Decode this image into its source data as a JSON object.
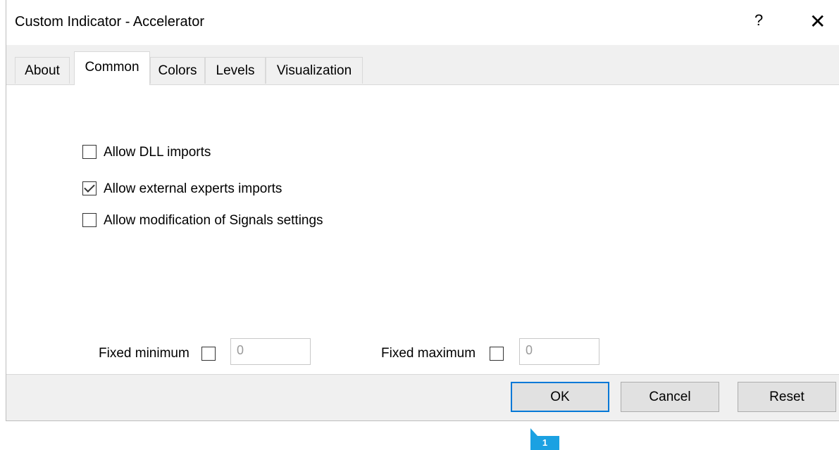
{
  "window": {
    "title": "Custom Indicator - Accelerator",
    "help_glyph": "?",
    "close_glyph": "✕"
  },
  "tabs": [
    {
      "label": "About"
    },
    {
      "label": "Common",
      "active": true
    },
    {
      "label": "Colors"
    },
    {
      "label": "Levels"
    },
    {
      "label": "Visualization"
    }
  ],
  "options": [
    {
      "label": "Allow DLL imports",
      "checked": false
    },
    {
      "label": "Allow external experts imports",
      "checked": true
    },
    {
      "label": "Allow modification of Signals settings",
      "checked": false
    }
  ],
  "scale": {
    "fixed_minimum": {
      "label": "Fixed minimum",
      "checked": false,
      "value": "0"
    },
    "fixed_maximum": {
      "label": "Fixed maximum",
      "checked": false,
      "value": "0"
    }
  },
  "buttons": {
    "ok": "OK",
    "cancel": "Cancel",
    "reset": "Reset"
  },
  "annotation": {
    "badge": "1",
    "color": "#1ba1e2"
  }
}
